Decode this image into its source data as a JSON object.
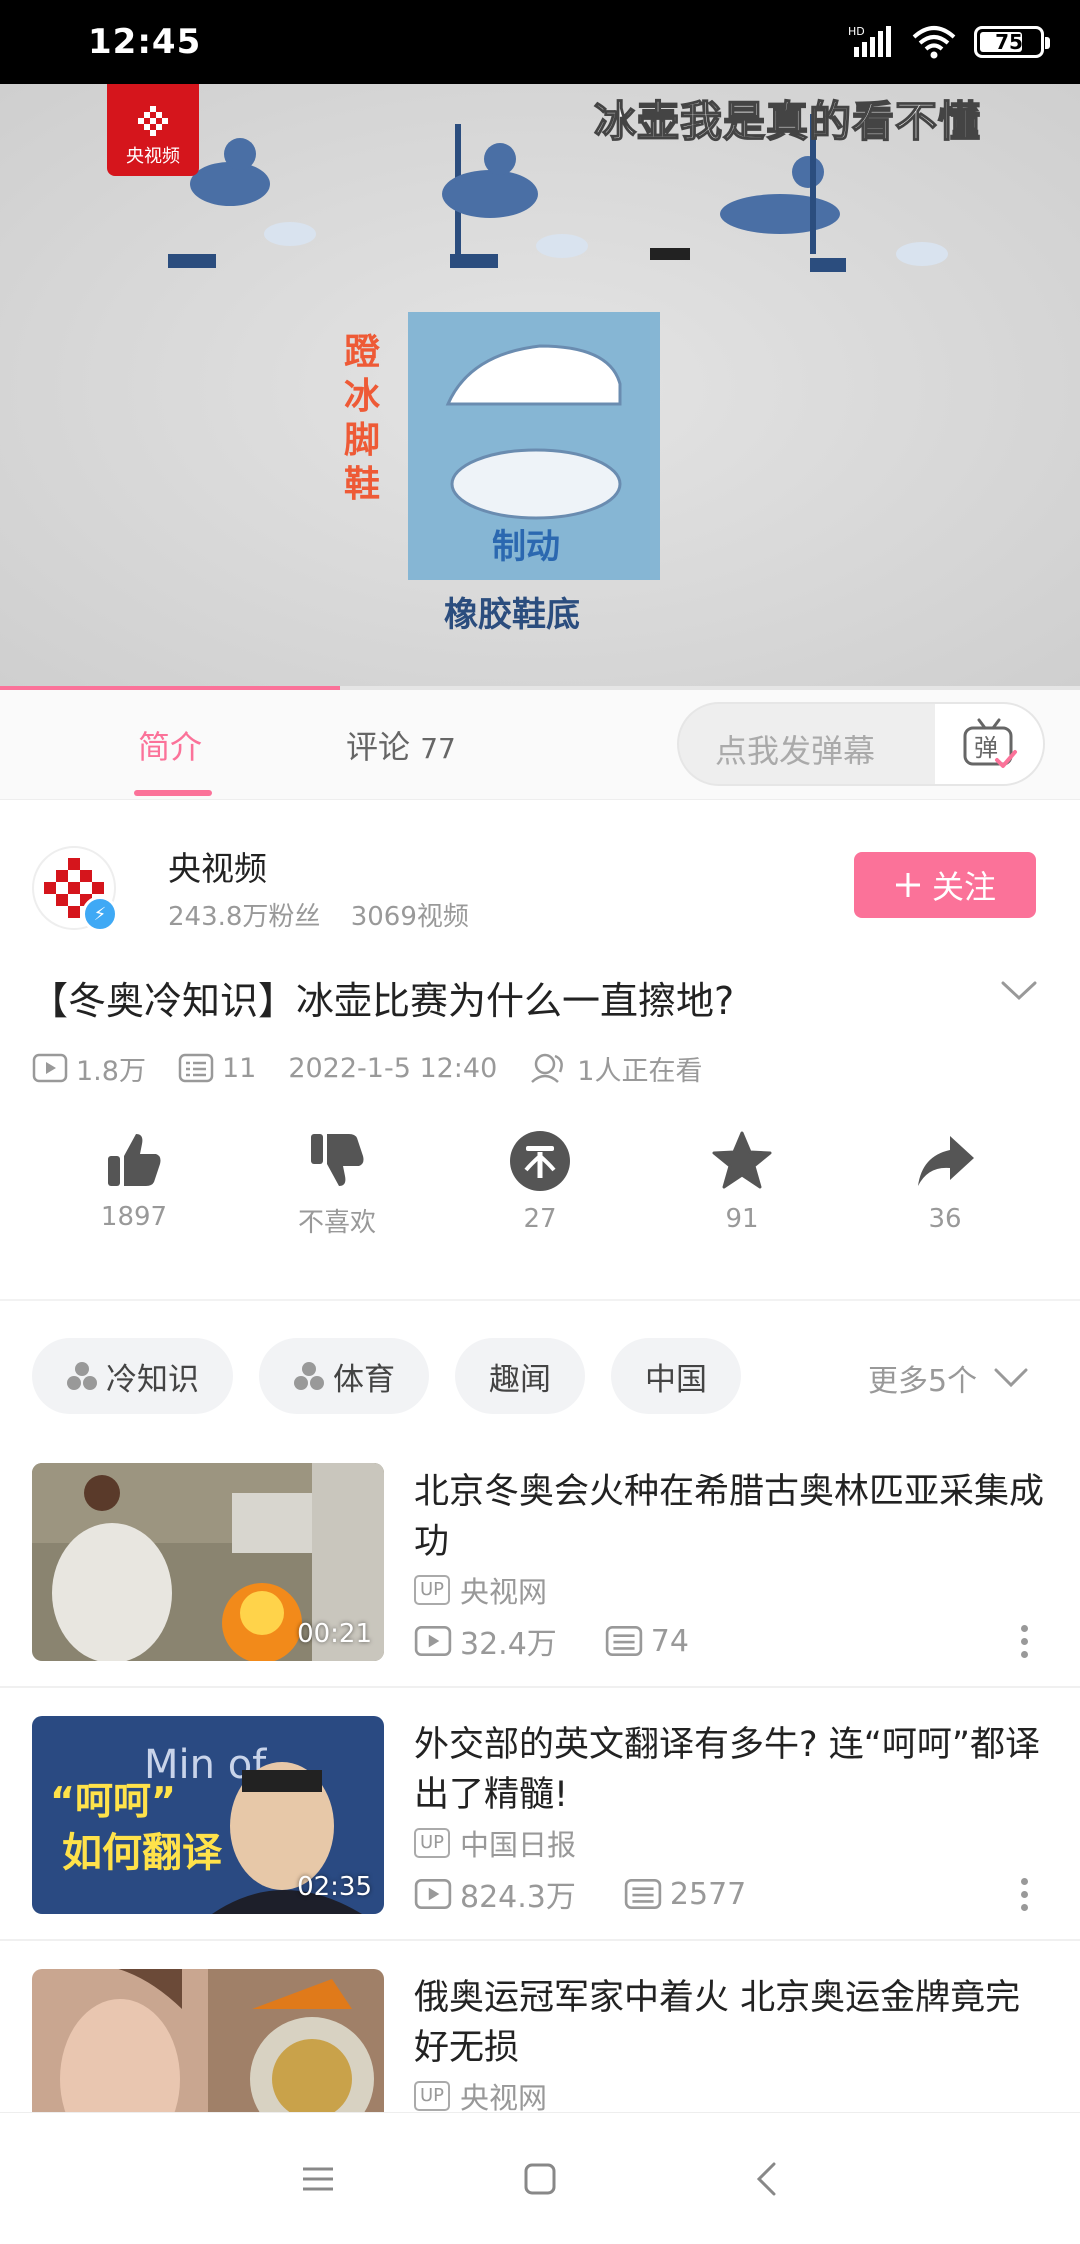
{
  "status_bar": {
    "time": "12:45",
    "network_label": "HD",
    "battery": "75",
    "battery_level": 0.75
  },
  "video": {
    "channel_logo_text": "央视频",
    "danmaku_overlay": "冰壶我是真的看不懂",
    "scene_caption_vertical": "蹬冰脚鞋",
    "scene_label_brake": "制动",
    "scene_label_sole": "橡胶鞋底",
    "progress": 0.315
  },
  "tabs": [
    {
      "label": "简介",
      "active": true
    },
    {
      "label": "评论",
      "count": "77",
      "active": false
    }
  ],
  "danmaku_input": {
    "placeholder": "点我发弹幕",
    "button_label": "弹"
  },
  "author": {
    "name": "央视频",
    "fans": "243.8万粉丝",
    "videos": "3069视频",
    "follow_label": "关注",
    "follow_icon": "plus-icon"
  },
  "video_info": {
    "title": "【冬奥冷知识】冰壶比赛为什么一直擦地?",
    "views": "1.8万",
    "danmaku_count": "11",
    "date": "2022-1-5 12:40",
    "watching": "1人正在看"
  },
  "actions": [
    {
      "name": "like",
      "icon": "thumbs-up-icon",
      "label": "1897"
    },
    {
      "name": "dislike",
      "icon": "thumbs-down-icon",
      "label": "不喜欢"
    },
    {
      "name": "coin",
      "icon": "coin-icon",
      "label": "27"
    },
    {
      "name": "favorite",
      "icon": "star-icon",
      "label": "91"
    },
    {
      "name": "share",
      "icon": "share-icon",
      "label": "36"
    }
  ],
  "tags": [
    {
      "label": "冷知识",
      "icon": "topic-icon"
    },
    {
      "label": "体育",
      "icon": "topic-icon"
    },
    {
      "label": "趣闻"
    },
    {
      "label": "中国"
    }
  ],
  "tags_more": "更多5个",
  "recommendations": [
    {
      "title": "北京冬奥会火种在希腊古奥林匹亚采集成功",
      "author": "央视网",
      "duration": "00:21",
      "views": "32.4万",
      "danmaku": "74",
      "thumb_text": ""
    },
    {
      "title": "外交部的英文翻译有多牛? 连“呵呵”都译出了精髓!",
      "author": "中国日报",
      "duration": "02:35",
      "views": "824.3万",
      "danmaku": "2577",
      "thumb_text": "Min of",
      "thumb_caption_1": "“呵呵”",
      "thumb_caption_2": "如何翻译"
    },
    {
      "title": "俄奥运冠军家中着火 北京奥运金牌竟完好无损",
      "author": "央视网",
      "duration": "",
      "views": "",
      "danmaku": ""
    }
  ],
  "up_badge": "UP",
  "colors": {
    "accent": "#fb7299",
    "verify": "#3fa9f5",
    "cctv_red": "#d5151c"
  }
}
